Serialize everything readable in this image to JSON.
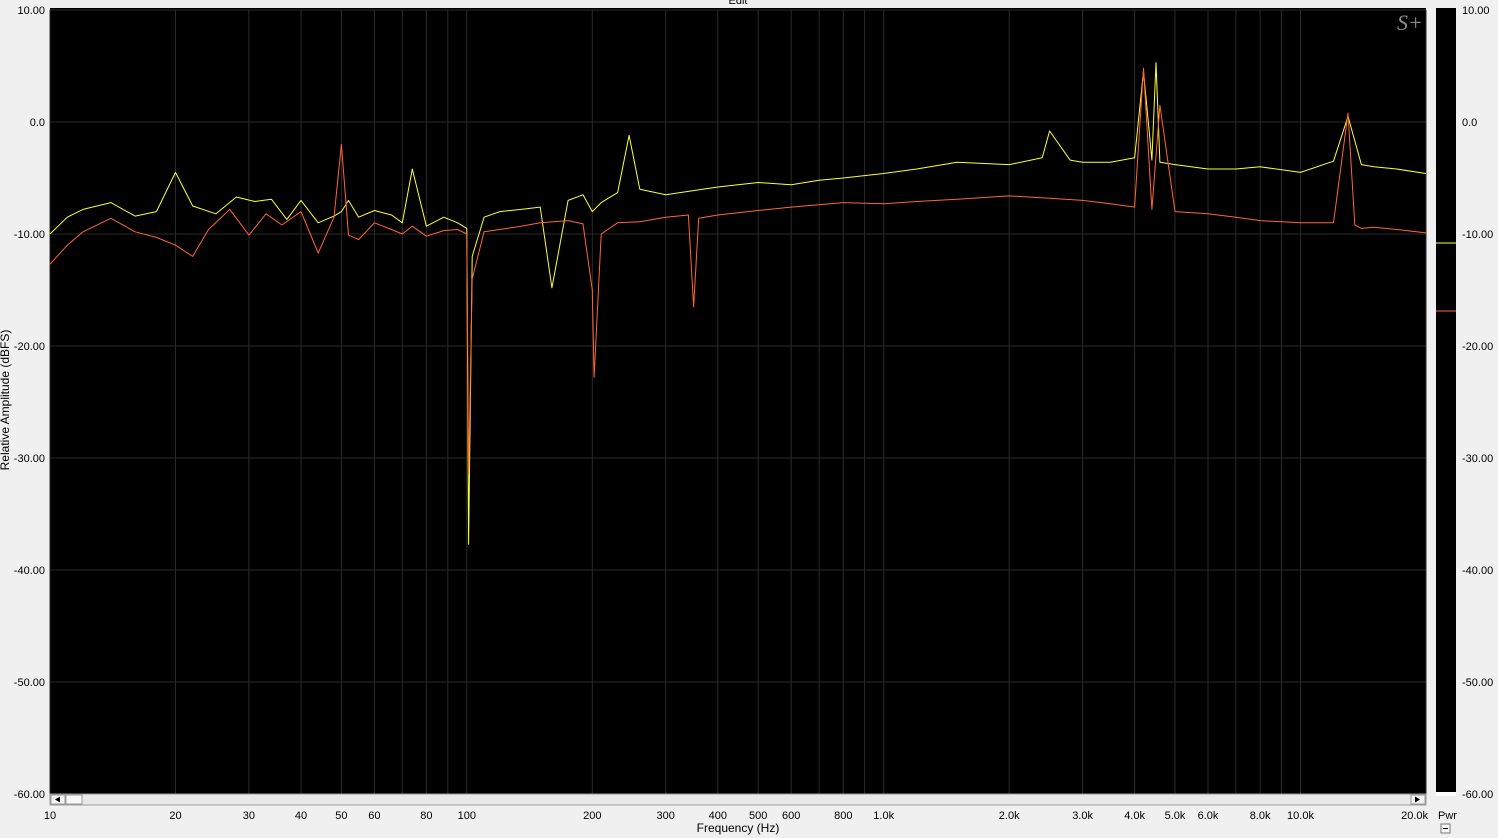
{
  "chart_data": {
    "type": "line",
    "title": "Edit",
    "xlabel": "Frequency (Hz)",
    "ylabel": "Relative Amplitude (dBFS)",
    "x_scale": "log",
    "xlim": [
      10,
      20000
    ],
    "ylim": [
      -60,
      10
    ],
    "grid": true,
    "background": "#000000",
    "x_ticks": [
      {
        "value": 10,
        "label": "10"
      },
      {
        "value": 20,
        "label": "20"
      },
      {
        "value": 30,
        "label": "30"
      },
      {
        "value": 40,
        "label": "40"
      },
      {
        "value": 50,
        "label": "50"
      },
      {
        "value": 60,
        "label": "60"
      },
      {
        "value": 80,
        "label": "80"
      },
      {
        "value": 100,
        "label": "100"
      },
      {
        "value": 200,
        "label": "200"
      },
      {
        "value": 300,
        "label": "300"
      },
      {
        "value": 400,
        "label": "400"
      },
      {
        "value": 500,
        "label": "500"
      },
      {
        "value": 600,
        "label": "600"
      },
      {
        "value": 800,
        "label": "800"
      },
      {
        "value": 1000,
        "label": "1.0k"
      },
      {
        "value": 2000,
        "label": "2.0k"
      },
      {
        "value": 3000,
        "label": "3.0k"
      },
      {
        "value": 4000,
        "label": "4.0k"
      },
      {
        "value": 5000,
        "label": "5.0k"
      },
      {
        "value": 6000,
        "label": "6.0k"
      },
      {
        "value": 8000,
        "label": "8.0k"
      },
      {
        "value": 10000,
        "label": "10.0k"
      },
      {
        "value": 20000,
        "label": "20.0k"
      }
    ],
    "y_ticks": [
      {
        "value": 10,
        "label": "10.00"
      },
      {
        "value": 0,
        "label": "0.0"
      },
      {
        "value": -10,
        "label": "-10.00"
      },
      {
        "value": -20,
        "label": "-20.00"
      },
      {
        "value": -30,
        "label": "-30.00"
      },
      {
        "value": -40,
        "label": "-40.00"
      },
      {
        "value": -50,
        "label": "-50.00"
      },
      {
        "value": -60,
        "label": "-60.00"
      }
    ],
    "series": [
      {
        "color": "#ffff33",
        "x": [
          10,
          11,
          12,
          14,
          16,
          18,
          20,
          22,
          25,
          28,
          31,
          34,
          37,
          40,
          44,
          48,
          50,
          52,
          55,
          60,
          66,
          70,
          74,
          80,
          88,
          95,
          100,
          101,
          103,
          110,
          120,
          135,
          150,
          160,
          175,
          190,
          200,
          210,
          230,
          245,
          260,
          300,
          340,
          400,
          500,
          600,
          700,
          800,
          1000,
          1200,
          1500,
          2000,
          2400,
          2500,
          2800,
          3000,
          3500,
          4000,
          4200,
          4400,
          4500,
          4600,
          5000,
          6000,
          7000,
          8000,
          10000,
          12000,
          13000,
          14000,
          15000,
          17000,
          20000
        ],
        "y": [
          -10,
          -8.5,
          -7.8,
          -7.2,
          -8.4,
          -8.0,
          -4.5,
          -7.5,
          -8.2,
          -6.7,
          -7.1,
          -6.9,
          -8.7,
          -7.0,
          -9.0,
          -8.4,
          -8.0,
          -7.0,
          -8.5,
          -7.9,
          -8.3,
          -9.0,
          -4.2,
          -9.3,
          -8.5,
          -9.0,
          -9.5,
          -37.7,
          -12.0,
          -8.5,
          -8.0,
          -7.8,
          -7.6,
          -14.8,
          -7.0,
          -6.5,
          -8.0,
          -7.2,
          -6.3,
          -1.2,
          -6.0,
          -6.5,
          -6.2,
          -5.8,
          -5.4,
          -5.6,
          -5.2,
          -5.0,
          -4.6,
          -4.2,
          -3.6,
          -3.8,
          -3.2,
          -0.8,
          -3.4,
          -3.6,
          -3.6,
          -3.2,
          4.5,
          -3.4,
          5.3,
          -3.6,
          -3.8,
          -4.2,
          -4.2,
          -4.0,
          -4.5,
          -3.5,
          0.5,
          -3.8,
          -4.0,
          -4.2,
          -4.6
        ]
      },
      {
        "color": "#ff6633",
        "x": [
          10,
          11,
          12,
          14,
          16,
          18,
          20,
          22,
          24,
          27,
          30,
          33,
          36,
          40,
          44,
          48,
          50,
          52,
          55,
          60,
          66,
          70,
          74,
          80,
          88,
          95,
          100,
          101,
          103,
          110,
          120,
          135,
          150,
          175,
          190,
          200,
          202,
          210,
          230,
          260,
          300,
          340,
          350,
          360,
          400,
          500,
          600,
          800,
          1000,
          1200,
          1500,
          2000,
          2500,
          3000,
          3500,
          4000,
          4200,
          4400,
          4600,
          5000,
          6000,
          7000,
          8000,
          10000,
          12000,
          13000,
          13500,
          14000,
          15000,
          17000,
          20000
        ],
        "y": [
          -12.7,
          -11.0,
          -9.8,
          -8.6,
          -9.8,
          -10.3,
          -11.0,
          -12.0,
          -9.6,
          -7.8,
          -10.1,
          -8.2,
          -9.2,
          -8.0,
          -11.7,
          -8.5,
          -2.0,
          -10.1,
          -10.5,
          -9.0,
          -9.6,
          -10.0,
          -9.3,
          -10.2,
          -9.7,
          -9.6,
          -10.0,
          -31.5,
          -14.0,
          -9.8,
          -9.6,
          -9.3,
          -9.0,
          -8.8,
          -9.1,
          -15.0,
          -22.8,
          -10.0,
          -9.0,
          -8.9,
          -8.5,
          -8.3,
          -16.5,
          -8.6,
          -8.3,
          -7.9,
          -7.6,
          -7.2,
          -7.3,
          -7.1,
          -6.9,
          -6.6,
          -6.8,
          -7.0,
          -7.3,
          -7.6,
          4.8,
          -7.8,
          1.5,
          -8.0,
          -8.2,
          -8.5,
          -8.8,
          -9.0,
          -9.0,
          0.8,
          -9.2,
          -9.5,
          -9.4,
          -9.6,
          -9.9
        ]
      }
    ]
  },
  "ui": {
    "watermark": "S+",
    "right_panel_label": "Pwr"
  }
}
